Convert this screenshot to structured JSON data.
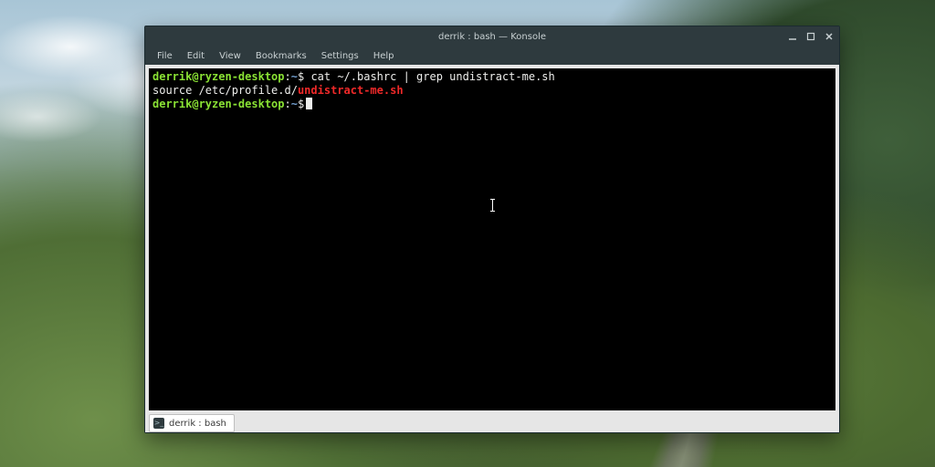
{
  "window": {
    "title": "derrik : bash — Konsole"
  },
  "menubar": {
    "items": [
      "File",
      "Edit",
      "View",
      "Bookmarks",
      "Settings",
      "Help"
    ]
  },
  "terminal": {
    "lines": [
      {
        "prompt_user_host": "derrik@ryzen-desktop",
        "prompt_sep": ":",
        "prompt_cwd": "~",
        "prompt_suffix": "$",
        "command": "cat ~/.bashrc | grep undistract-me.sh"
      },
      {
        "output_prefix": "source /etc/profile.d/",
        "output_match": "undistract-me.sh"
      },
      {
        "prompt_user_host": "derrik@ryzen-desktop",
        "prompt_sep": ":",
        "prompt_cwd": "~",
        "prompt_suffix": "$",
        "command": ""
      }
    ]
  },
  "tabs": {
    "active": "derrik : bash"
  },
  "colors": {
    "titlebar_bg": "#2e3a3e",
    "terminal_bg": "#000000",
    "prompt_user": "#8ae234",
    "prompt_cwd": "#729fcf",
    "grep_match": "#ef2929"
  }
}
